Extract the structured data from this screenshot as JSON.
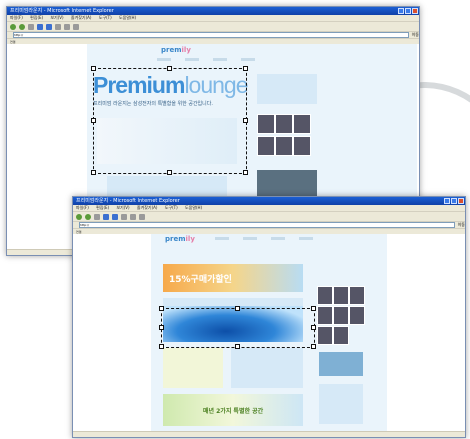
{
  "back_window": {
    "title": "프리미엄라운지 - Microsoft Internet Explorer",
    "menu": [
      "파일(F)",
      "편집(E)",
      "보기(V)",
      "즐겨찾기(A)",
      "도구(T)",
      "도움말(H)"
    ],
    "address": "http://",
    "go": "이동",
    "links": "연결",
    "site": {
      "logo_prefix": "prem",
      "logo_suffix": "ily",
      "heading_bold": "Premium",
      "heading_light": "lounge",
      "subtext": "프리미엄 라운지는 삼성전자의 특별함을 위한 공간입니다."
    }
  },
  "front_window": {
    "title": "프리미엄라운지 - Microsoft Internet Explorer",
    "menu": [
      "파일(F)",
      "편집(E)",
      "보기(V)",
      "즐겨찾기(A)",
      "도구(T)",
      "도움말(H)"
    ],
    "address": "http://",
    "go": "이동",
    "links": "연결",
    "site": {
      "logo_prefix": "prem",
      "logo_suffix": "ily",
      "banner1_text": "15%구매가할인",
      "banner3_text": "매년 2가지 특별한 공간"
    }
  },
  "colors": {
    "accent": "#3d8fd6",
    "selection": "#111111",
    "site_bg": "#eaf4fb"
  }
}
